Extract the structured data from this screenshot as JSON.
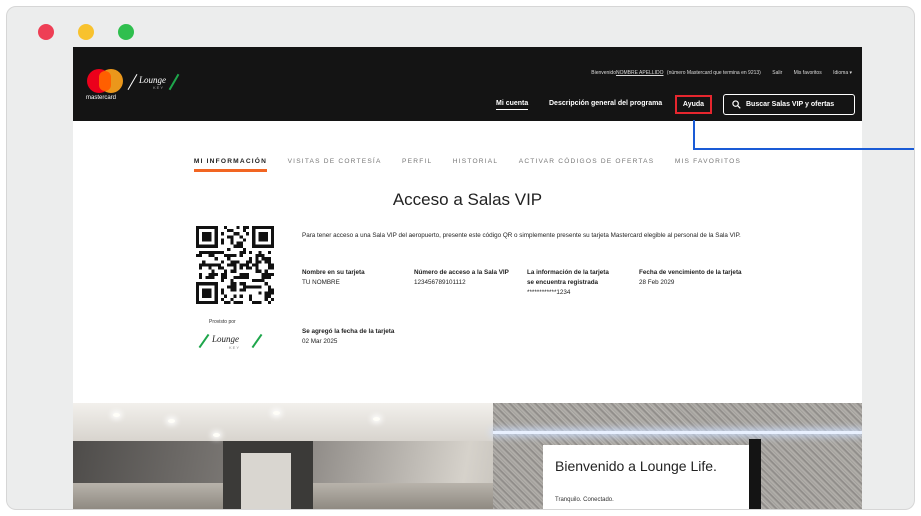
{
  "window": {
    "controls": [
      "close",
      "minimize",
      "maximize"
    ]
  },
  "header": {
    "brand": "mastercard",
    "lounge_logo_word": "Lounge",
    "lounge_logo_sub": "KEY",
    "welcome_prefix": "Bienvenido",
    "user_name": "NOMBRE APELLIDO",
    "card_note": "(número Mastercard que termina en 9213)",
    "logout": "Salir",
    "favorites": "Mis favoritos",
    "language": "Idioma ▾",
    "nav_account": "Mi cuenta",
    "nav_program": "Descripción general del programa",
    "nav_help": "Ayuda",
    "search_button": "Buscar Salas VIP y ofertas"
  },
  "tabs": [
    {
      "label": "MI INFORMACIÓN",
      "active": true
    },
    {
      "label": "VISITAS DE CORTESÍA",
      "active": false
    },
    {
      "label": "PERFIL",
      "active": false
    },
    {
      "label": "HISTORIAL",
      "active": false
    },
    {
      "label": "ACTIVAR CÓDIGOS DE OFERTAS",
      "active": false
    },
    {
      "label": "MIS FAVORITOS",
      "active": false
    }
  ],
  "main": {
    "title": "Acceso a Salas VIP",
    "intro": "Para tener acceso a una Sala VIP del aeropuerto, presente este código QR o simplemente presente su tarjeta Mastercard elegible al personal de la Sala VIP.",
    "provided_by": "Provisto por",
    "fields": {
      "name_label": "Nombre en su tarjeta",
      "name_value": "TU NOMBRE",
      "access_label": "Número de acceso a la Sala VIP",
      "access_value": "123456789101112",
      "card_label": "La información de la tarjeta se encuentra registrada",
      "card_value": "************1234",
      "expiry_label": "Fecha de vencimiento de la tarjeta",
      "expiry_value": "28 Feb 2029",
      "added_label": "Se agregó la fecha de la tarjeta",
      "added_value": "02 Mar 2025"
    }
  },
  "hero": {
    "title": "Bienvenido a Lounge Life.",
    "subtitle": "Tranquilo. Conectado."
  },
  "colors": {
    "header_bg": "#141414",
    "accent_tab": "#f26522",
    "highlight_box": "#e6262e",
    "pointer_line": "#1a5bd6",
    "lounge_green": "#1ea64b"
  }
}
